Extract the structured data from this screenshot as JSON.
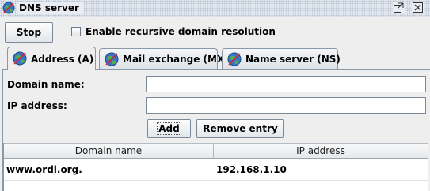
{
  "window": {
    "title": "DNS server",
    "icon": "globe-icon"
  },
  "toolbar": {
    "stop_label": "Stop",
    "recursive_label": "Enable recursive domain resolution",
    "recursive_checked": false
  },
  "tabs": [
    {
      "label": "Address (A)",
      "icon": "globe-icon",
      "selected": true
    },
    {
      "label": "Mail exchange (MX)",
      "icon": "globe-icon",
      "selected": false
    },
    {
      "label": "Name server (NS)",
      "icon": "globe-icon",
      "selected": false
    }
  ],
  "form": {
    "domain_label": "Domain name:",
    "domain_value": "",
    "ip_label": "IP address:",
    "ip_value": "",
    "add_label": "Add",
    "remove_label": "Remove entry"
  },
  "table": {
    "columns": [
      "Domain name",
      "IP address"
    ],
    "rows": [
      {
        "domain": "www.ordi.org.",
        "ip": "192.168.1.10"
      }
    ]
  }
}
